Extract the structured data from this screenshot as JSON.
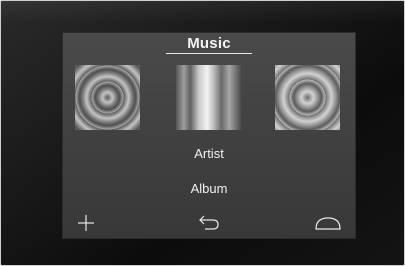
{
  "screen": {
    "title": "Music",
    "menu": [
      {
        "label": "Artist"
      },
      {
        "label": "Album"
      }
    ],
    "artwork": [
      {
        "icon": "album-art-concentric"
      },
      {
        "icon": "album-art-stripes"
      },
      {
        "icon": "album-art-concentric"
      }
    ],
    "bottom_bar": [
      {
        "icon": "plus-icon"
      },
      {
        "icon": "back-arrow-icon"
      },
      {
        "icon": "dome-icon"
      }
    ]
  },
  "colors": {
    "panel": "#444444",
    "text": "#f0f0f0",
    "bezel": "#141414"
  }
}
